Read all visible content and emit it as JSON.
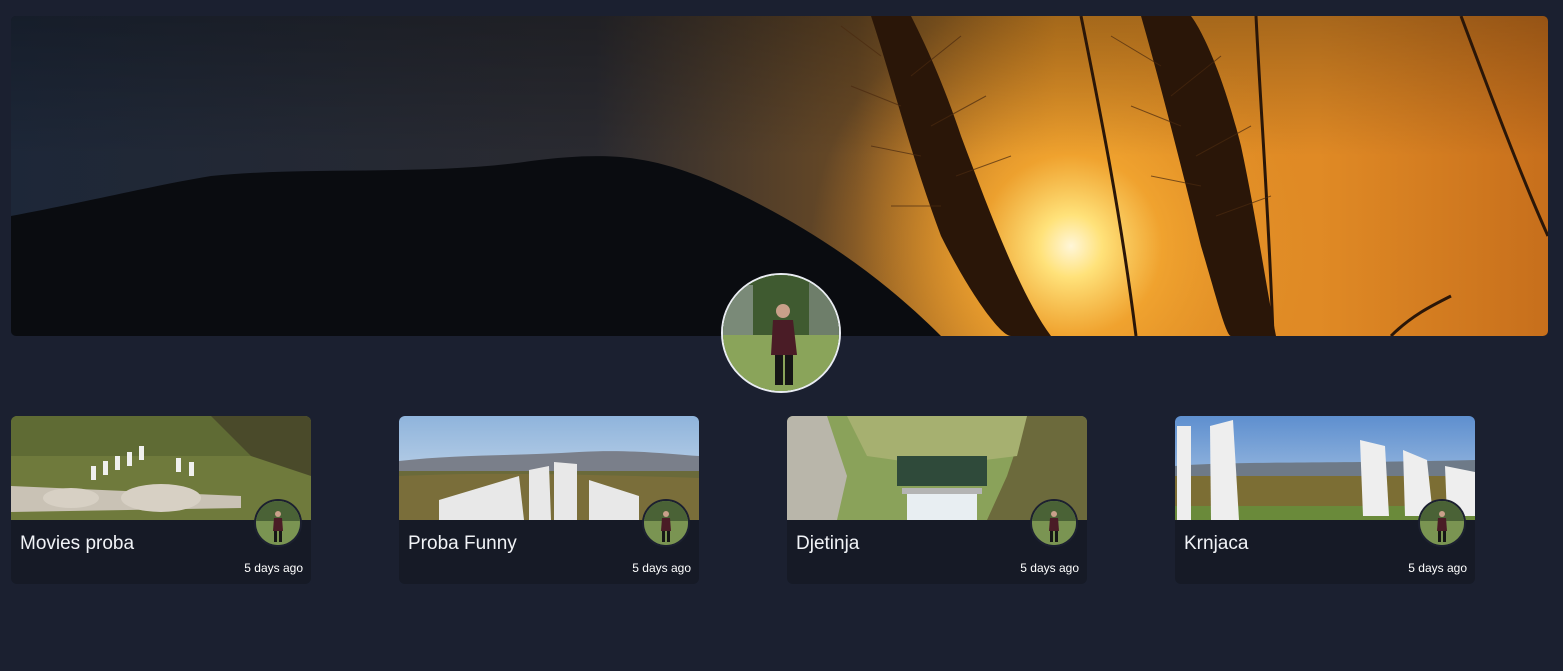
{
  "cover": {
    "image": "sunset-grass-cover"
  },
  "profile": {
    "avatar": "user-profile-photo"
  },
  "posts": [
    {
      "title": "Movies proba",
      "time": "5 days ago",
      "thumb": "aerial-monument"
    },
    {
      "title": "Proba Funny",
      "time": "5 days ago",
      "thumb": "monument-hills"
    },
    {
      "title": "Djetinja",
      "time": "5 days ago",
      "thumb": "river-canyon-dam"
    },
    {
      "title": "Krnjaca",
      "time": "5 days ago",
      "thumb": "white-stone-monoliths"
    }
  ],
  "colors": {
    "background": "#1b2030",
    "card": "#161a26",
    "text": "#f1f3f7",
    "sun": "#ffd86b",
    "sky_orange": "#e88a1c"
  }
}
